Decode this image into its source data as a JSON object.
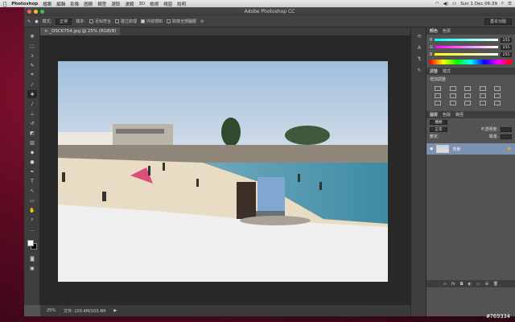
{
  "macbar": {
    "apple": "",
    "app": "Photoshop",
    "menus": [
      "檔案",
      "編輯",
      "影像",
      "圖層",
      "類型",
      "選取",
      "濾鏡",
      "3D",
      "檢視",
      "視窗",
      "說明"
    ],
    "clock": "Sun 1 Dec 06:39",
    "status_icons": [
      "wifi-icon",
      "volume-icon",
      "battery-icon"
    ]
  },
  "window": {
    "title": "Adobe Photoshop CC"
  },
  "options": {
    "mode_label": "模式:",
    "mode_value": "正常",
    "sample_label": "樣本:",
    "opt1": "近似符合",
    "opt2": "建立紋理",
    "opt3": "內容感知",
    "opt4": "取樣全部圖層",
    "workspace": "基本功能"
  },
  "doc": {
    "tab": "_DSC6754.jpg @ 25% (RGB/8)"
  },
  "status": {
    "zoom": "25%",
    "doc_size": "文件: 103.4M/103.4M"
  },
  "color_panel": {
    "tabs": [
      "顏色",
      "色票"
    ],
    "rows": [
      {
        "label": "R",
        "value": "255"
      },
      {
        "label": "G",
        "value": "255"
      },
      {
        "label": "B",
        "value": "255"
      }
    ]
  },
  "adjust_panel": {
    "tabs": [
      "調整",
      "樣式"
    ],
    "subtitle": "增加調整"
  },
  "layers_panel": {
    "tabs": [
      "圖層",
      "色版",
      "路徑"
    ],
    "kind": "種類",
    "mode": "正常",
    "opacity_label": "不透明度:",
    "lock_label": "鎖定:",
    "fill_label": "填滿:",
    "layer_name": "背景"
  },
  "watermark": "#769334",
  "colors": {
    "accent": "#7c90b0",
    "bg": "#535353"
  }
}
